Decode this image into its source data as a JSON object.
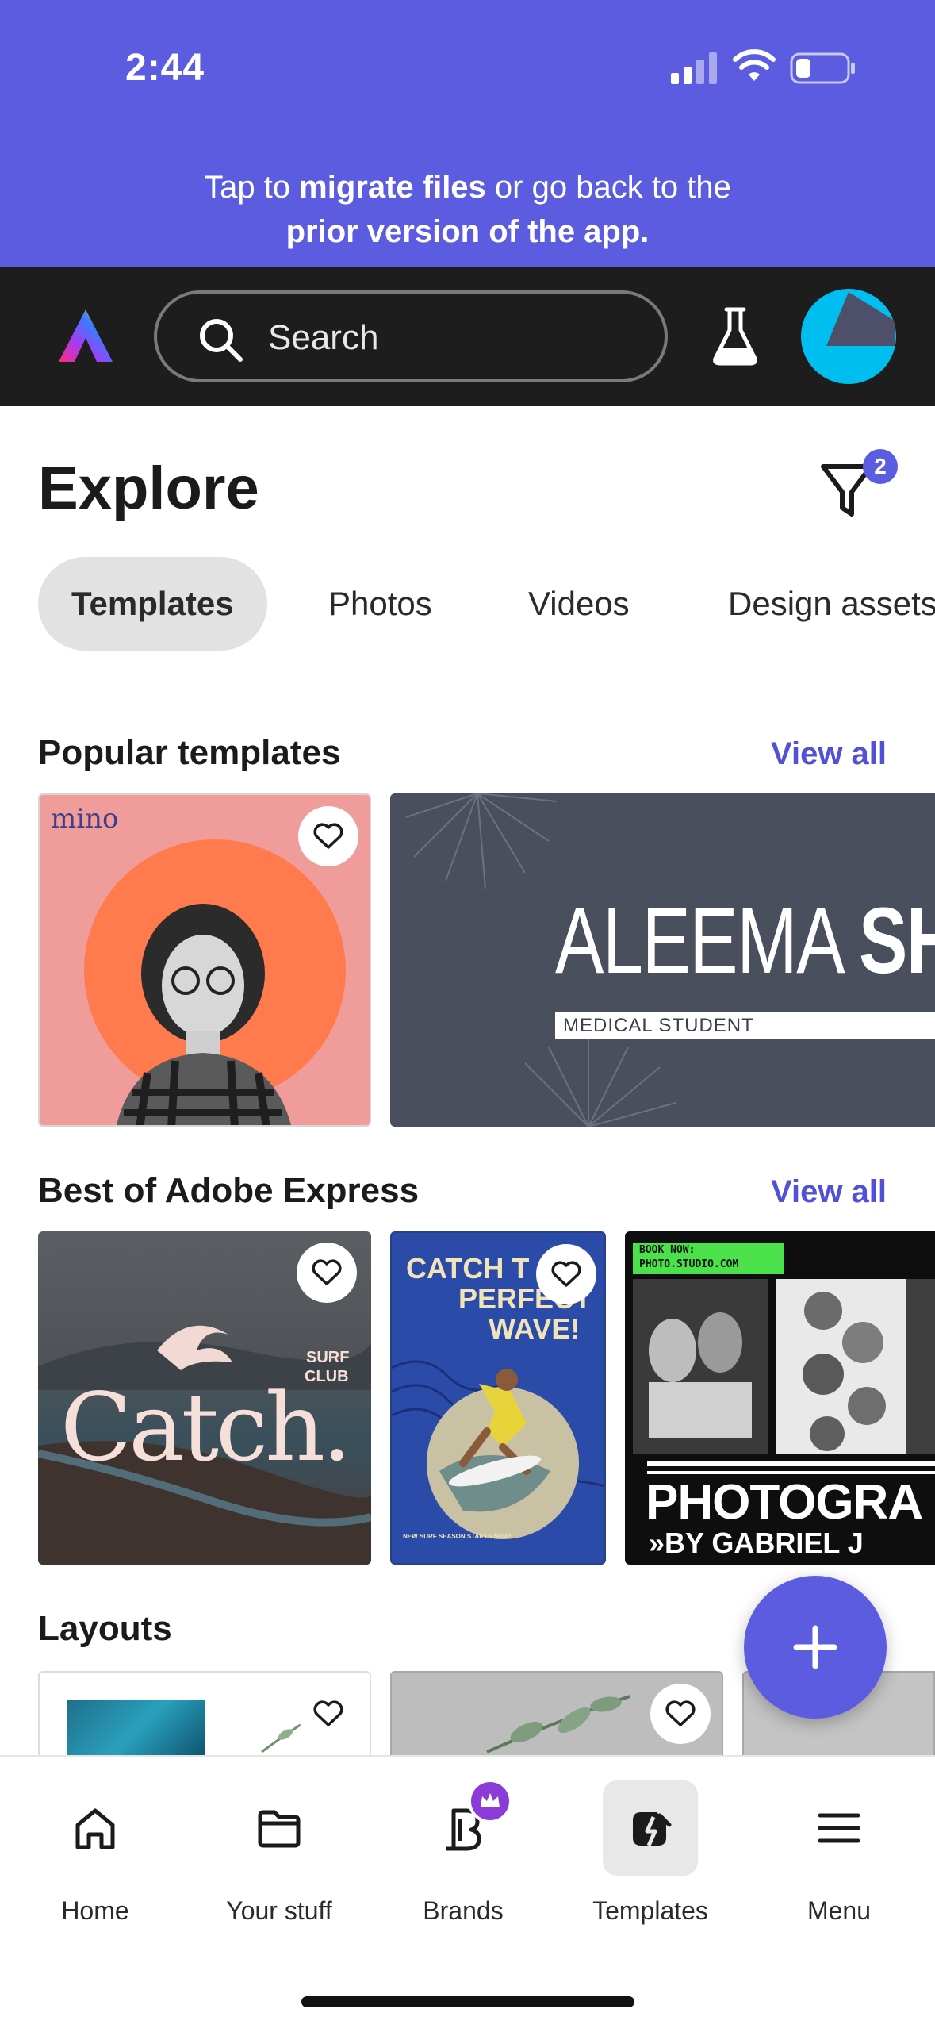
{
  "status_bar": {
    "time": "2:44"
  },
  "banner": {
    "prefix": "Tap to ",
    "link1": "migrate files",
    "middle": " or go back to the",
    "link2": "prior version of the app."
  },
  "header": {
    "search_placeholder": "Search"
  },
  "explore": {
    "title": "Explore",
    "filter_count": "2",
    "tabs": [
      {
        "label": "Templates",
        "active": true
      },
      {
        "label": "Photos",
        "active": false
      },
      {
        "label": "Videos",
        "active": false
      },
      {
        "label": "Design assets",
        "active": false
      }
    ]
  },
  "sections": {
    "popular": {
      "title": "Popular templates",
      "view_all": "View all"
    },
    "best": {
      "title": "Best of Adobe Express",
      "view_all": "View all"
    },
    "layouts": {
      "title": "Layouts"
    }
  },
  "cards": {
    "mino": {
      "brand": "mino"
    },
    "aleema": {
      "name_light": "ALEEMA ",
      "name_bold": "SH",
      "subtitle": "MEDICAL STUDENT"
    },
    "catch": {
      "title": "Catch.",
      "line1": "SURF",
      "line2": "CLUB"
    },
    "wave": {
      "head1": "CATCH T",
      "head2": "PERFECT",
      "head3": "WAVE!",
      "footer": "NEW SURF SEASON STARTS NOW!"
    },
    "photo": {
      "tag1": "BOOK NOW:",
      "tag2": "PHOTO.STUDIO.COM",
      "big": "PHOTOGRA",
      "by": "»BY GABRIEL J"
    }
  },
  "bottom_nav": [
    {
      "label": "Home",
      "icon": "home-icon"
    },
    {
      "label": "Your stuff",
      "icon": "folder-icon"
    },
    {
      "label": "Brands",
      "icon": "brands-icon"
    },
    {
      "label": "Templates",
      "icon": "templates-icon",
      "active": true
    },
    {
      "label": "Menu",
      "icon": "menu-icon"
    }
  ],
  "colors": {
    "accent": "#5c5ce0",
    "link": "#5151d8",
    "header_bg": "#1d1d1d"
  }
}
